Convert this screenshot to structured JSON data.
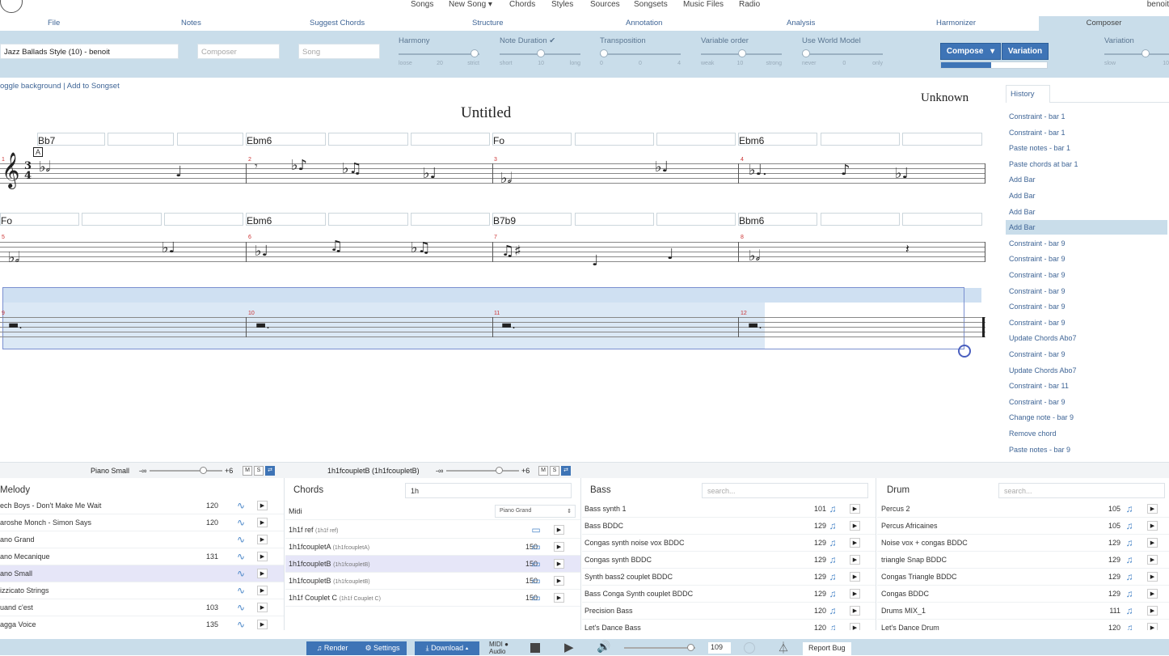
{
  "nav": {
    "items": [
      "Songs",
      "New Song ▾",
      "Chords",
      "Styles",
      "Sources",
      "Songsets",
      "Music Files",
      "Radio"
    ],
    "user": "benoit"
  },
  "tabs": [
    "File",
    "Notes",
    "Suggest Chords",
    "Structure",
    "Annotation",
    "Analysis",
    "Harmonizer",
    "Composer"
  ],
  "toolbar": {
    "style_value": "Jazz Ballads Style (10) - benoit",
    "composer_placeholder": "Composer",
    "song_placeholder": "Song",
    "sliders": [
      {
        "label": "Harmony",
        "ticks": [
          "loose",
          "20",
          "strict"
        ],
        "level": 0.97
      },
      {
        "label": "Note Duration ✔",
        "ticks": [
          "short",
          "10",
          "long"
        ],
        "level": 0.5
      },
      {
        "label": "Transposition",
        "ticks": [
          "0",
          "0",
          "4"
        ],
        "level": 0.0
      },
      {
        "label": "Variable order",
        "ticks": [
          "weak",
          "10",
          "strong"
        ],
        "level": 0.5
      },
      {
        "label": "Use World Model",
        "ticks": [
          "never",
          "0",
          "only"
        ],
        "level": 0.0
      }
    ],
    "compose_label": "Compose",
    "variation_label": "Variation",
    "variation_slider_label": "Variation",
    "variation_ticks": [
      "slow",
      "10"
    ],
    "progress": 0.47
  },
  "score": {
    "links": "oggle background | Add to Songset",
    "title": "Untitled",
    "composer": "Unknown",
    "rehearsal": "A",
    "time_sig_top": "3",
    "time_sig_bottom": "4",
    "row1_chords": [
      "Bb7",
      "Ebm6",
      "Fo",
      "Ebm6"
    ],
    "row2_chords": [
      "Fo",
      "Ebm6",
      "B7b9",
      "Bbm6"
    ],
    "bar_numbers": [
      "1",
      "2",
      "3",
      "4",
      "5",
      "6",
      "7",
      "8",
      "9",
      "10",
      "11",
      "12"
    ]
  },
  "history": {
    "tab": "History",
    "items": [
      "Constraint - bar 1",
      "Constraint - bar 1",
      "Paste notes - bar 1",
      "Paste chords at bar 1",
      "Add Bar",
      "Add Bar",
      "Add Bar",
      "Add Bar",
      "Constraint - bar 9",
      "Constraint - bar 9",
      "Constraint - bar 9",
      "Constraint - bar 9",
      "Constraint - bar 9",
      "Constraint - bar 9",
      "Update Chords Abo7",
      "Constraint - bar 9",
      "Update Chords Abo7",
      "Constraint - bar 11",
      "Constraint - bar 9",
      "Change note - bar 9",
      "Remove chord",
      "Paste notes - bar 9"
    ],
    "selected": 7
  },
  "mixer": {
    "left_label": "Piano Small",
    "left_min": "-∞",
    "left_max": "+6",
    "right_label": "1h1fcoupletB (1h1fcoupletB)",
    "right_min": "-∞",
    "right_max": "+6",
    "m": "M",
    "s": "S"
  },
  "melody": {
    "title": "Melody",
    "rows": [
      {
        "name": "ech Boys - Don't Make Me Wait",
        "bpm": "120"
      },
      {
        "name": "aroshe Monch - Simon Says",
        "bpm": "120"
      },
      {
        "name": "ano Grand",
        "bpm": ""
      },
      {
        "name": "ano Mecanique",
        "bpm": "131"
      },
      {
        "name": "ano Small",
        "bpm": ""
      },
      {
        "name": "izzicato Strings",
        "bpm": ""
      },
      {
        "name": "uand c'est",
        "bpm": "103"
      },
      {
        "name": "agga Voice",
        "bpm": "135"
      }
    ],
    "selected": 4
  },
  "chords_panel": {
    "title": "Chords",
    "search": "1h",
    "midi_label": "Midi",
    "instrument": "Piano Grand",
    "rows": [
      {
        "name": "1h1f ref",
        "sub": "(1h1f ref)",
        "bpm": ""
      },
      {
        "name": "1h1fcoupletA",
        "sub": "(1h1fcoupletA)",
        "bpm": "150"
      },
      {
        "name": "1h1fcoupletB",
        "sub": "(1h1fcoupletB)",
        "bpm": "150"
      },
      {
        "name": "1h1fcoupletB",
        "sub": "(1h1fcoupletB)",
        "bpm": "150"
      },
      {
        "name": "1h1f Couplet C",
        "sub": "(1h1f Couplet C)",
        "bpm": "150"
      }
    ],
    "selected": 2
  },
  "bass": {
    "title": "Bass",
    "search_placeholder": "search...",
    "rows": [
      {
        "name": "Bass synth 1",
        "bpm": "101"
      },
      {
        "name": "Bass BDDC",
        "bpm": "129"
      },
      {
        "name": "Congas synth noise vox BDDC",
        "bpm": "129"
      },
      {
        "name": "Congas synth BDDC",
        "bpm": "129"
      },
      {
        "name": "Synth bass2 couplet BDDC",
        "bpm": "129"
      },
      {
        "name": "Bass Conga Synth couplet BDDC",
        "bpm": "129"
      },
      {
        "name": "Precision Bass",
        "bpm": "120"
      },
      {
        "name": "Let's Dance Bass",
        "bpm": "120"
      }
    ]
  },
  "drum": {
    "title": "Drum",
    "search_placeholder": "search...",
    "rows": [
      {
        "name": "Percus 2",
        "bpm": "105"
      },
      {
        "name": "Percus Africaines",
        "bpm": "105"
      },
      {
        "name": "Noise vox + congas BDDC",
        "bpm": "129"
      },
      {
        "name": "triangle Snap BDDC",
        "bpm": "129"
      },
      {
        "name": "Congas Triangle BDDC",
        "bpm": "129"
      },
      {
        "name": "Congas BDDC",
        "bpm": "129"
      },
      {
        "name": "Drums MIX_1",
        "bpm": "111"
      },
      {
        "name": "Let's Dance Drum",
        "bpm": "120"
      }
    ]
  },
  "bottom": {
    "render": "♫ Render",
    "settings": "⚙ Settings",
    "download": "⤓ Download ▴",
    "midi": "MIDI ●",
    "audio": "Audio",
    "tempo": "109",
    "report": "Report Bug"
  },
  "colors": {
    "accent": "#3e74b6",
    "panel_bg": "#c9ddea",
    "link": "#3f6596"
  }
}
